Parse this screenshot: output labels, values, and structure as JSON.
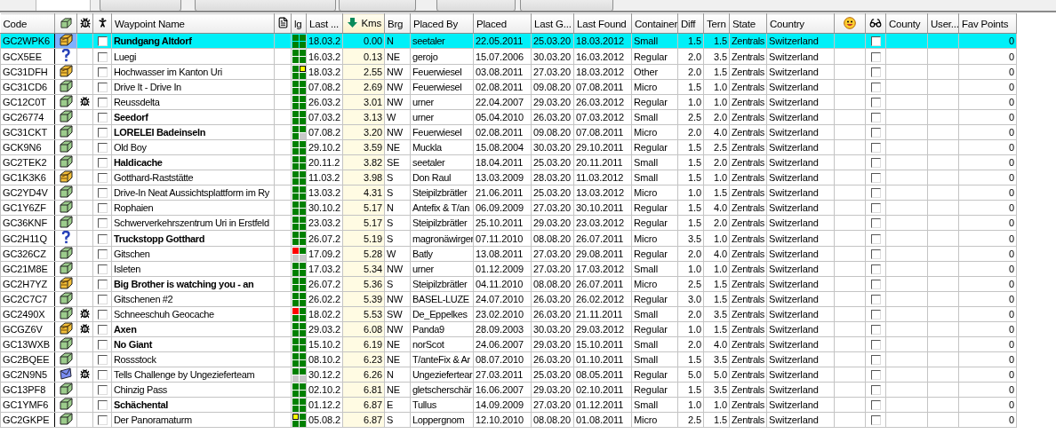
{
  "toolbar": {
    "controls": [
      {
        "kind": "field"
      },
      {
        "kind": "button"
      },
      {
        "kind": "button"
      },
      {
        "kind": "button"
      },
      {
        "kind": "button"
      },
      {
        "kind": "button"
      }
    ]
  },
  "columns": [
    {
      "kind": "text",
      "label": "Code",
      "sorted": false
    },
    {
      "kind": "cache-type",
      "sorted": false
    },
    {
      "kind": "bug",
      "sorted": false
    },
    {
      "kind": "person",
      "sorted": false
    },
    {
      "kind": "text",
      "label": "Waypoint Name",
      "sorted": false
    },
    {
      "kind": "notes",
      "sorted": false
    },
    {
      "kind": "text",
      "label": "lg",
      "sorted": false
    },
    {
      "kind": "text",
      "label": "Last ...",
      "sorted": false
    },
    {
      "kind": "text",
      "label": "Kms",
      "sorted": true
    },
    {
      "kind": "text",
      "label": "Brg",
      "sorted": false
    },
    {
      "kind": "text",
      "label": "Placed By",
      "sorted": false
    },
    {
      "kind": "text",
      "label": "Placed",
      "sorted": false
    },
    {
      "kind": "text",
      "label": "Last G...",
      "sorted": false
    },
    {
      "kind": "text",
      "label": "Last Found",
      "sorted": false
    },
    {
      "kind": "text",
      "label": "Container",
      "sorted": false
    },
    {
      "kind": "text",
      "label": "Diff",
      "sorted": false
    },
    {
      "kind": "text",
      "label": "Tern",
      "sorted": false
    },
    {
      "kind": "text",
      "label": "State",
      "sorted": false
    },
    {
      "kind": "text",
      "label": "Country",
      "sorted": false
    },
    {
      "kind": "smiley",
      "sorted": false
    },
    {
      "kind": "glasses",
      "sorted": false
    },
    {
      "kind": "text",
      "label": "County",
      "sorted": false
    },
    {
      "kind": "text",
      "label": "User...",
      "sorted": false
    },
    {
      "kind": "text",
      "label": "Fav Points",
      "sorted": false
    }
  ],
  "rows": [
    {
      "code": "GC2WPK6",
      "kind": "multi",
      "bug": false,
      "checked": false,
      "name": "Rundgang Altdorf",
      "emphasized": true,
      "selected": true,
      "recent_logs": [
        {
          "kind": "found"
        },
        {
          "kind": "found"
        },
        {
          "kind": "found"
        },
        {
          "kind": "found"
        }
      ],
      "last_log": "18.03.2",
      "kms": "0.00",
      "brg": "N",
      "placed_by": "seetaler",
      "placed": "22.05.2011",
      "last_gpx": "25.03.20",
      "last_found": "18.03.2012",
      "container": "Small",
      "diff": "1.5",
      "tern": "1.5",
      "state": "Zentrals",
      "country": "Switzerland",
      "watched": false,
      "fav_points": "0"
    },
    {
      "code": "GCX5EE",
      "kind": "mystery",
      "bug": false,
      "checked": false,
      "name": "Luegi",
      "emphasized": false,
      "selected": false,
      "recent_logs": [
        {
          "kind": "found"
        },
        {
          "kind": "found"
        },
        {
          "kind": "found"
        },
        {
          "kind": "found"
        }
      ],
      "last_log": "16.03.2",
      "kms": "0.13",
      "brg": "NE",
      "placed_by": "gerojo",
      "placed": "15.07.2006",
      "last_gpx": "30.03.20",
      "last_found": "16.03.2012",
      "container": "Regular",
      "diff": "2.0",
      "tern": "3.5",
      "state": "Zentrals",
      "country": "Switzerland",
      "watched": false,
      "fav_points": "0"
    },
    {
      "code": "GC31DFH",
      "kind": "multi",
      "bug": false,
      "checked": false,
      "name": "Hochwasser im Kanton Uri",
      "emphasized": false,
      "selected": false,
      "recent_logs": [
        {
          "kind": "found"
        },
        {
          "kind": "note"
        },
        {
          "kind": "found"
        },
        {
          "kind": "found"
        }
      ],
      "last_log": "18.03.2",
      "kms": "2.55",
      "brg": "NW",
      "placed_by": "Feuerwiesel",
      "placed": "03.08.2011",
      "last_gpx": "27.03.20",
      "last_found": "18.03.2012",
      "container": "Other",
      "diff": "2.0",
      "tern": "1.5",
      "state": "Zentrals",
      "country": "Switzerland",
      "watched": false,
      "fav_points": "0"
    },
    {
      "code": "GC31CD6",
      "kind": "traditional",
      "bug": false,
      "checked": false,
      "name": "Drive It - Drive In",
      "emphasized": false,
      "selected": false,
      "recent_logs": [
        {
          "kind": "found"
        },
        {
          "kind": "found"
        },
        {
          "kind": "found"
        },
        {
          "kind": "found"
        }
      ],
      "last_log": "07.08.2",
      "kms": "2.69",
      "brg": "NW",
      "placed_by": "Feuerwiesel",
      "placed": "02.08.2011",
      "last_gpx": "09.08.20",
      "last_found": "07.08.2011",
      "container": "Micro",
      "diff": "1.5",
      "tern": "1.0",
      "state": "Zentrals",
      "country": "Switzerland",
      "watched": false,
      "fav_points": "0"
    },
    {
      "code": "GC12C0T",
      "kind": "traditional",
      "bug": true,
      "checked": false,
      "name": "Reussdelta",
      "emphasized": false,
      "selected": false,
      "recent_logs": [
        {
          "kind": "found"
        },
        {
          "kind": "found"
        },
        {
          "kind": "found"
        },
        {
          "kind": "found"
        }
      ],
      "last_log": "26.03.2",
      "kms": "3.01",
      "brg": "NW",
      "placed_by": "urner",
      "placed": "22.04.2007",
      "last_gpx": "29.03.20",
      "last_found": "26.03.2012",
      "container": "Regular",
      "diff": "1.0",
      "tern": "1.0",
      "state": "Zentrals",
      "country": "Switzerland",
      "watched": false,
      "fav_points": "0"
    },
    {
      "code": "GC26774",
      "kind": "traditional",
      "bug": false,
      "checked": false,
      "name": "Seedorf",
      "emphasized": true,
      "selected": false,
      "recent_logs": [
        {
          "kind": "found"
        },
        {
          "kind": "found"
        },
        {
          "kind": "found"
        },
        {
          "kind": "found"
        }
      ],
      "last_log": "07.03.2",
      "kms": "3.13",
      "brg": "W",
      "placed_by": "urner",
      "placed": "05.04.2010",
      "last_gpx": "26.03.20",
      "last_found": "07.03.2012",
      "container": "Small",
      "diff": "2.5",
      "tern": "2.0",
      "state": "Zentrals",
      "country": "Switzerland",
      "watched": false,
      "fav_points": "0"
    },
    {
      "code": "GC31CKT",
      "kind": "traditional",
      "bug": false,
      "checked": false,
      "name": "LORELEI Badeinseln",
      "emphasized": true,
      "selected": false,
      "recent_logs": [
        {
          "kind": "found"
        },
        {
          "kind": "found"
        },
        {
          "kind": "found"
        },
        {
          "kind": "none"
        }
      ],
      "last_log": "07.08.2",
      "kms": "3.20",
      "brg": "NW",
      "placed_by": "Feuerwiesel",
      "placed": "02.08.2011",
      "last_gpx": "09.08.20",
      "last_found": "07.08.2011",
      "container": "Micro",
      "diff": "2.0",
      "tern": "4.0",
      "state": "Zentrals",
      "country": "Switzerland",
      "watched": false,
      "fav_points": "0"
    },
    {
      "code": "GCK9N6",
      "kind": "traditional",
      "bug": false,
      "checked": false,
      "name": "Old Boy",
      "emphasized": false,
      "selected": false,
      "recent_logs": [
        {
          "kind": "found"
        },
        {
          "kind": "found"
        },
        {
          "kind": "found"
        },
        {
          "kind": "found"
        }
      ],
      "last_log": "29.10.2",
      "kms": "3.59",
      "brg": "NE",
      "placed_by": "Muckla",
      "placed": "15.08.2004",
      "last_gpx": "30.03.20",
      "last_found": "29.10.2011",
      "container": "Regular",
      "diff": "1.5",
      "tern": "2.5",
      "state": "Zentrals",
      "country": "Switzerland",
      "watched": false,
      "fav_points": "0"
    },
    {
      "code": "GC2TEK2",
      "kind": "traditional",
      "bug": false,
      "checked": false,
      "name": "Haldicache",
      "emphasized": true,
      "selected": false,
      "recent_logs": [
        {
          "kind": "found"
        },
        {
          "kind": "found"
        },
        {
          "kind": "found"
        },
        {
          "kind": "found"
        }
      ],
      "last_log": "20.11.2",
      "kms": "3.82",
      "brg": "SE",
      "placed_by": "seetaler",
      "placed": "18.04.2011",
      "last_gpx": "25.03.20",
      "last_found": "20.11.2011",
      "container": "Small",
      "diff": "1.5",
      "tern": "2.0",
      "state": "Zentrals",
      "country": "Switzerland",
      "watched": false,
      "fav_points": "0"
    },
    {
      "code": "GC1K3K6",
      "kind": "multi",
      "bug": false,
      "checked": false,
      "name": "Gotthard-Raststätte",
      "emphasized": false,
      "selected": false,
      "recent_logs": [
        {
          "kind": "found"
        },
        {
          "kind": "found"
        },
        {
          "kind": "found"
        },
        {
          "kind": "found"
        }
      ],
      "last_log": "11.03.2",
      "kms": "3.98",
      "brg": "S",
      "placed_by": "Don Raul",
      "placed": "13.03.2009",
      "last_gpx": "28.03.20",
      "last_found": "11.03.2012",
      "container": "Small",
      "diff": "1.5",
      "tern": "1.0",
      "state": "Zentrals",
      "country": "Switzerland",
      "watched": false,
      "fav_points": "0"
    },
    {
      "code": "GC2YD4V",
      "kind": "traditional",
      "bug": false,
      "checked": false,
      "name": "Drive-In Neat Aussichtsplattform im Ry",
      "emphasized": false,
      "selected": false,
      "recent_logs": [
        {
          "kind": "found"
        },
        {
          "kind": "found"
        },
        {
          "kind": "found"
        },
        {
          "kind": "found"
        }
      ],
      "last_log": "13.03.2",
      "kms": "4.31",
      "brg": "S",
      "placed_by": "Steipilzbrätler",
      "placed": "21.06.2011",
      "last_gpx": "25.03.20",
      "last_found": "13.03.2012",
      "container": "Micro",
      "diff": "1.0",
      "tern": "1.5",
      "state": "Zentrals",
      "country": "Switzerland",
      "watched": false,
      "fav_points": "0"
    },
    {
      "code": "GC1Y6ZF",
      "kind": "traditional",
      "bug": false,
      "checked": false,
      "name": "Rophaien",
      "emphasized": false,
      "selected": false,
      "recent_logs": [
        {
          "kind": "found"
        },
        {
          "kind": "found"
        },
        {
          "kind": "found"
        },
        {
          "kind": "found"
        }
      ],
      "last_log": "30.10.2",
      "kms": "5.17",
      "brg": "N",
      "placed_by": "Antefix & T/an",
      "placed": "06.09.2009",
      "last_gpx": "27.03.20",
      "last_found": "30.10.2011",
      "container": "Regular",
      "diff": "1.5",
      "tern": "4.0",
      "state": "Zentrals",
      "country": "Switzerland",
      "watched": false,
      "fav_points": "0"
    },
    {
      "code": "GC36KNF",
      "kind": "traditional",
      "bug": false,
      "checked": false,
      "name": "Schwerverkehrszentrum Uri in Erstfeld",
      "emphasized": false,
      "selected": false,
      "recent_logs": [
        {
          "kind": "found"
        },
        {
          "kind": "found"
        },
        {
          "kind": "found"
        },
        {
          "kind": "found"
        }
      ],
      "last_log": "23.03.2",
      "kms": "5.17",
      "brg": "S",
      "placed_by": "Steipilzbrätler",
      "placed": "25.10.2011",
      "last_gpx": "29.03.20",
      "last_found": "23.03.2012",
      "container": "Regular",
      "diff": "1.5",
      "tern": "2.0",
      "state": "Zentrals",
      "country": "Switzerland",
      "watched": false,
      "fav_points": "0"
    },
    {
      "code": "GC2H11Q",
      "kind": "mystery",
      "bug": false,
      "checked": false,
      "name": "Truckstopp Gotthard",
      "emphasized": true,
      "selected": false,
      "recent_logs": [
        {
          "kind": "found"
        },
        {
          "kind": "found"
        },
        {
          "kind": "found"
        },
        {
          "kind": "found"
        }
      ],
      "last_log": "26.07.2",
      "kms": "5.19",
      "brg": "S",
      "placed_by": "magronäwirger",
      "placed": "07.11.2010",
      "last_gpx": "08.08.20",
      "last_found": "26.07.2011",
      "container": "Micro",
      "diff": "3.5",
      "tern": "1.0",
      "state": "Zentrals",
      "country": "Switzerland",
      "watched": false,
      "fav_points": "0"
    },
    {
      "code": "GC326CZ",
      "kind": "traditional",
      "bug": false,
      "checked": false,
      "name": "Gitschen",
      "emphasized": false,
      "selected": false,
      "recent_logs": [
        {
          "kind": "dnf"
        },
        {
          "kind": "found"
        },
        {
          "kind": "none"
        },
        {
          "kind": "none"
        }
      ],
      "last_log": "17.09.2",
      "kms": "5.28",
      "brg": "W",
      "placed_by": "Batly",
      "placed": "13.08.2011",
      "last_gpx": "27.03.20",
      "last_found": "29.08.2011",
      "container": "Regular",
      "diff": "2.0",
      "tern": "4.0",
      "state": "Zentrals",
      "country": "Switzerland",
      "watched": false,
      "fav_points": "0"
    },
    {
      "code": "GC21M8E",
      "kind": "traditional",
      "bug": false,
      "checked": false,
      "name": "Isleten",
      "emphasized": false,
      "selected": false,
      "recent_logs": [
        {
          "kind": "found"
        },
        {
          "kind": "found"
        },
        {
          "kind": "found"
        },
        {
          "kind": "found"
        }
      ],
      "last_log": "17.03.2",
      "kms": "5.34",
      "brg": "NW",
      "placed_by": "urner",
      "placed": "01.12.2009",
      "last_gpx": "27.03.20",
      "last_found": "17.03.2012",
      "container": "Small",
      "diff": "1.0",
      "tern": "1.0",
      "state": "Zentrals",
      "country": "Switzerland",
      "watched": false,
      "fav_points": "0"
    },
    {
      "code": "GC2H7YZ",
      "kind": "multi",
      "bug": false,
      "checked": false,
      "name": "Big Brother is watching you - an",
      "emphasized": true,
      "selected": false,
      "recent_logs": [
        {
          "kind": "found"
        },
        {
          "kind": "found"
        },
        {
          "kind": "found"
        },
        {
          "kind": "found"
        }
      ],
      "last_log": "26.07.2",
      "kms": "5.36",
      "brg": "S",
      "placed_by": "Steipilzbrätler",
      "placed": "04.11.2010",
      "last_gpx": "08.08.20",
      "last_found": "26.07.2011",
      "container": "Micro",
      "diff": "2.5",
      "tern": "1.5",
      "state": "Zentrals",
      "country": "Switzerland",
      "watched": false,
      "fav_points": "0"
    },
    {
      "code": "GC2C7C7",
      "kind": "traditional",
      "bug": false,
      "checked": false,
      "name": "Gitschenen #2",
      "emphasized": false,
      "selected": false,
      "recent_logs": [
        {
          "kind": "found"
        },
        {
          "kind": "found"
        },
        {
          "kind": "found"
        },
        {
          "kind": "found"
        }
      ],
      "last_log": "26.02.2",
      "kms": "5.39",
      "brg": "NW",
      "placed_by": "BASEL-LUZE",
      "placed": "24.07.2010",
      "last_gpx": "26.03.20",
      "last_found": "26.02.2012",
      "container": "Regular",
      "diff": "3.0",
      "tern": "1.5",
      "state": "Zentrals",
      "country": "Switzerland",
      "watched": false,
      "fav_points": "0"
    },
    {
      "code": "GC2490X",
      "kind": "traditional",
      "bug": true,
      "checked": false,
      "name": "Schneeschuh Geocache",
      "emphasized": false,
      "selected": false,
      "recent_logs": [
        {
          "kind": "dnf"
        },
        {
          "kind": "found"
        },
        {
          "kind": "found"
        },
        {
          "kind": "found"
        }
      ],
      "last_log": "18.02.2",
      "kms": "5.53",
      "brg": "SW",
      "placed_by": "De_Eppelkes",
      "placed": "23.02.2010",
      "last_gpx": "26.03.20",
      "last_found": "21.11.2011",
      "container": "Small",
      "diff": "2.0",
      "tern": "3.5",
      "state": "Zentrals",
      "country": "Switzerland",
      "watched": false,
      "fav_points": "0"
    },
    {
      "code": "GCGZ6V",
      "kind": "multi",
      "bug": true,
      "checked": false,
      "name": "Axen",
      "emphasized": true,
      "selected": false,
      "recent_logs": [
        {
          "kind": "found"
        },
        {
          "kind": "found"
        },
        {
          "kind": "found"
        },
        {
          "kind": "found"
        }
      ],
      "last_log": "29.03.2",
      "kms": "6.08",
      "brg": "NW",
      "placed_by": "Panda9",
      "placed": "28.09.2003",
      "last_gpx": "30.03.20",
      "last_found": "29.03.2012",
      "container": "Regular",
      "diff": "1.0",
      "tern": "1.5",
      "state": "Zentrals",
      "country": "Switzerland",
      "watched": false,
      "fav_points": "0"
    },
    {
      "code": "GC13WXB",
      "kind": "traditional",
      "bug": false,
      "checked": false,
      "name": "No Giant",
      "emphasized": true,
      "selected": false,
      "recent_logs": [
        {
          "kind": "found"
        },
        {
          "kind": "found"
        },
        {
          "kind": "found"
        },
        {
          "kind": "found"
        }
      ],
      "last_log": "15.10.2",
      "kms": "6.19",
      "brg": "NE",
      "placed_by": "norScot",
      "placed": "24.06.2007",
      "last_gpx": "29.03.20",
      "last_found": "15.10.2011",
      "container": "Small",
      "diff": "2.0",
      "tern": "4.0",
      "state": "Zentrals",
      "country": "Switzerland",
      "watched": false,
      "fav_points": "0"
    },
    {
      "code": "GC2BQEE",
      "kind": "traditional",
      "bug": false,
      "checked": false,
      "name": "Rossstock",
      "emphasized": false,
      "selected": false,
      "recent_logs": [
        {
          "kind": "found"
        },
        {
          "kind": "found"
        },
        {
          "kind": "found"
        },
        {
          "kind": "found"
        }
      ],
      "last_log": "08.10.2",
      "kms": "6.23",
      "brg": "NE",
      "placed_by": "T/anteFix & Ar",
      "placed": "08.07.2010",
      "last_gpx": "26.03.20",
      "last_found": "01.10.2011",
      "container": "Small",
      "diff": "1.5",
      "tern": "3.5",
      "state": "Zentrals",
      "country": "Switzerland",
      "watched": false,
      "fav_points": "0"
    },
    {
      "code": "GC2N9N5",
      "kind": "letterbox",
      "bug": true,
      "checked": false,
      "name": "Tells Challenge by Ungezieferteam",
      "emphasized": false,
      "selected": false,
      "recent_logs": [
        {
          "kind": "found"
        },
        {
          "kind": "found"
        },
        {
          "kind": "none"
        },
        {
          "kind": "none"
        }
      ],
      "last_log": "30.12.2",
      "kms": "6.26",
      "brg": "N",
      "placed_by": "Ungeziefertear",
      "placed": "27.03.2011",
      "last_gpx": "25.03.20",
      "last_found": "08.05.2011",
      "container": "Regular",
      "diff": "5.0",
      "tern": "5.0",
      "state": "Zentrals",
      "country": "Switzerland",
      "watched": false,
      "fav_points": "0"
    },
    {
      "code": "GC13PF8",
      "kind": "traditional",
      "bug": false,
      "checked": false,
      "name": "Chinzig Pass",
      "emphasized": false,
      "selected": false,
      "recent_logs": [
        {
          "kind": "found"
        },
        {
          "kind": "found"
        },
        {
          "kind": "found"
        },
        {
          "kind": "found"
        }
      ],
      "last_log": "02.10.2",
      "kms": "6.81",
      "brg": "NE",
      "placed_by": "gletscherschär",
      "placed": "16.06.2007",
      "last_gpx": "29.03.20",
      "last_found": "02.10.2011",
      "container": "Regular",
      "diff": "1.5",
      "tern": "3.5",
      "state": "Zentrals",
      "country": "Switzerland",
      "watched": false,
      "fav_points": "0"
    },
    {
      "code": "GC1YMF6",
      "kind": "traditional",
      "bug": false,
      "checked": false,
      "name": "Schächental",
      "emphasized": true,
      "selected": false,
      "recent_logs": [
        {
          "kind": "found"
        },
        {
          "kind": "found"
        },
        {
          "kind": "found"
        },
        {
          "kind": "found"
        }
      ],
      "last_log": "01.12.2",
      "kms": "6.87",
      "brg": "E",
      "placed_by": "Tullus",
      "placed": "14.09.2009",
      "last_gpx": "27.03.20",
      "last_found": "01.12.2011",
      "container": "Small",
      "diff": "1.0",
      "tern": "1.0",
      "state": "Zentrals",
      "country": "Switzerland",
      "watched": false,
      "fav_points": "0"
    },
    {
      "code": "GC2GKPE",
      "kind": "traditional",
      "bug": false,
      "checked": false,
      "name": "Der Panoramaturm",
      "emphasized": false,
      "selected": false,
      "recent_logs": [
        {
          "kind": "note"
        },
        {
          "kind": "found"
        },
        {
          "kind": "found"
        },
        {
          "kind": "found"
        }
      ],
      "last_log": "05.08.2",
      "kms": "6.87",
      "brg": "S",
      "placed_by": "Loppergnom",
      "placed": "12.10.2010",
      "last_gpx": "08.08.20",
      "last_found": "01.08.2011",
      "container": "Micro",
      "diff": "2.5",
      "tern": "1.5",
      "state": "Zentrals",
      "country": "Switzerland",
      "watched": false,
      "fav_points": "0"
    }
  ]
}
